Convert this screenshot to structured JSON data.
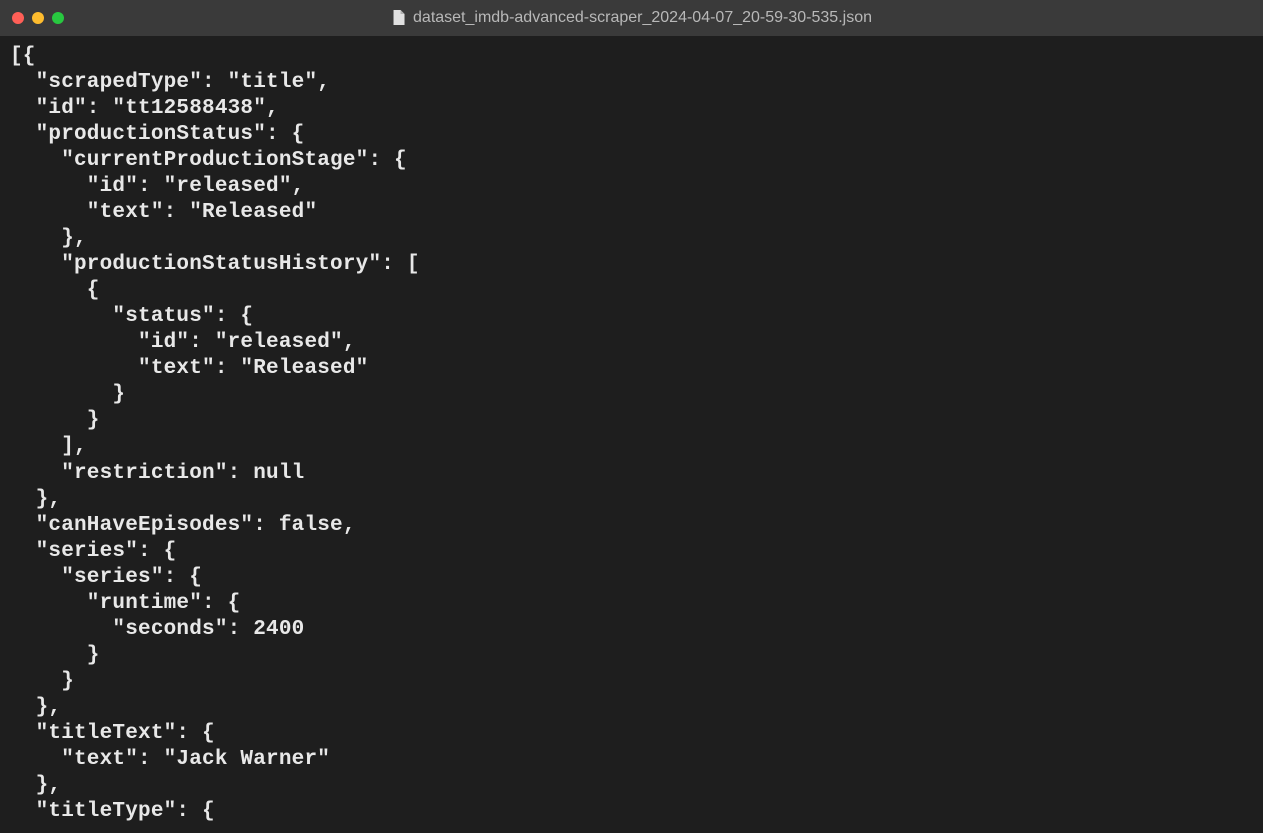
{
  "window": {
    "title": "dataset_imdb-advanced-scraper_2024-04-07_20-59-30-535.json"
  },
  "code": {
    "lines": [
      "[{",
      "  \"scrapedType\": \"title\",",
      "  \"id\": \"tt12588438\",",
      "  \"productionStatus\": {",
      "    \"currentProductionStage\": {",
      "      \"id\": \"released\",",
      "      \"text\": \"Released\"",
      "    },",
      "    \"productionStatusHistory\": [",
      "      {",
      "        \"status\": {",
      "          \"id\": \"released\",",
      "          \"text\": \"Released\"",
      "        }",
      "      }",
      "    ],",
      "    \"restriction\": null",
      "  },",
      "  \"canHaveEpisodes\": false,",
      "  \"series\": {",
      "    \"series\": {",
      "      \"runtime\": {",
      "        \"seconds\": 2400",
      "      }",
      "    }",
      "  },",
      "  \"titleText\": {",
      "    \"text\": \"Jack Warner\"",
      "  },",
      "  \"titleType\": {"
    ]
  }
}
